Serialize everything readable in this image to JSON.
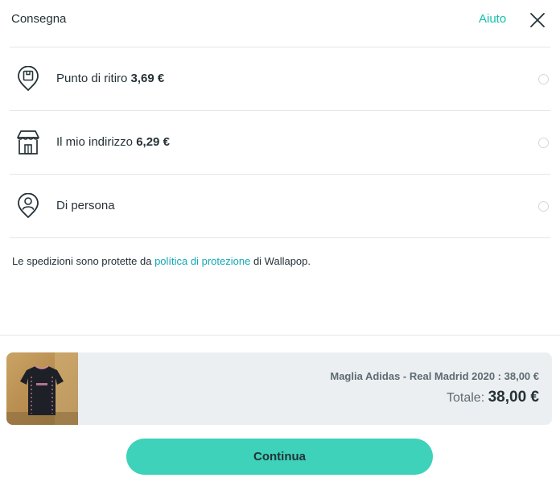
{
  "header": {
    "title": "Consegna",
    "help_label": "Aiuto",
    "close_icon": "close-icon"
  },
  "options": [
    {
      "icon": "pickup-point-icon",
      "label": "Punto di ritiro",
      "price": "3,69 €",
      "selected": false
    },
    {
      "icon": "home-address-icon",
      "label": "Il mio indirizzo",
      "price": "6,29 €",
      "selected": false
    },
    {
      "icon": "in-person-icon",
      "label": "Di persona",
      "price": "",
      "selected": false
    }
  ],
  "note": {
    "before": "Le spedizioni sono protette da ",
    "link": "política di protezione",
    "after": " di Wallapop."
  },
  "summary": {
    "product": "Maglia Adidas - Real Madrid 2020 : 38,00 €",
    "total_label": "Totale:",
    "total_value": "38,00 €"
  },
  "continue_label": "Continua",
  "colors": {
    "accent": "#13c1ac",
    "button": "#3dd2b9",
    "link": "#13a8b5",
    "summary_bg": "#eceff1"
  }
}
